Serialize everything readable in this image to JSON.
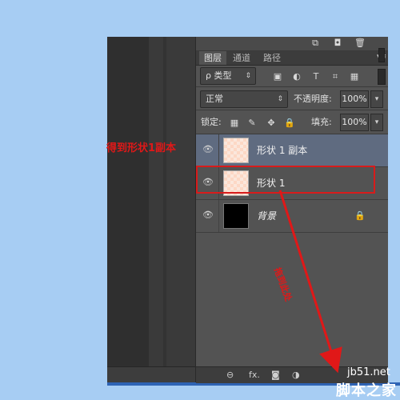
{
  "top_icons": [
    "new-layer-icon",
    "camera-icon",
    "trash-icon"
  ],
  "tabs": [
    {
      "label": "图层",
      "active": true
    },
    {
      "label": "通道",
      "active": false
    },
    {
      "label": "路径",
      "active": false
    }
  ],
  "filter": {
    "label": "ρ 类型",
    "icons": {
      "image": "▣",
      "adjust": "◐",
      "text": "T",
      "shape": "⌗",
      "smart": "▦"
    }
  },
  "blend": {
    "mode": "正常",
    "opacity_label": "不透明度:",
    "opacity_value": "100%"
  },
  "lock": {
    "label": "锁定:",
    "fill_label": "填充:",
    "fill_value": "100%"
  },
  "layers": [
    {
      "name": "形状 1 副本",
      "thumb": "peach",
      "selected": true
    },
    {
      "name": "形状 1",
      "thumb": "peach",
      "selected": false
    },
    {
      "name": "背景",
      "thumb": "black",
      "selected": false,
      "locked": true
    }
  ],
  "bottom_icons": {
    "link": "⊖",
    "fx": "fx.",
    "mask": "◙",
    "adjust": "◑"
  },
  "annotations": {
    "label_left": "得到形状1副本",
    "label_arrow": "拖到此处"
  },
  "watermark": {
    "site": "jb51.net",
    "name": "脚本之家"
  },
  "colors": {
    "background": "#a7cdf3",
    "panel": "#535353",
    "selected_row": "#5f6b80",
    "annotation_red": "#e01818"
  }
}
